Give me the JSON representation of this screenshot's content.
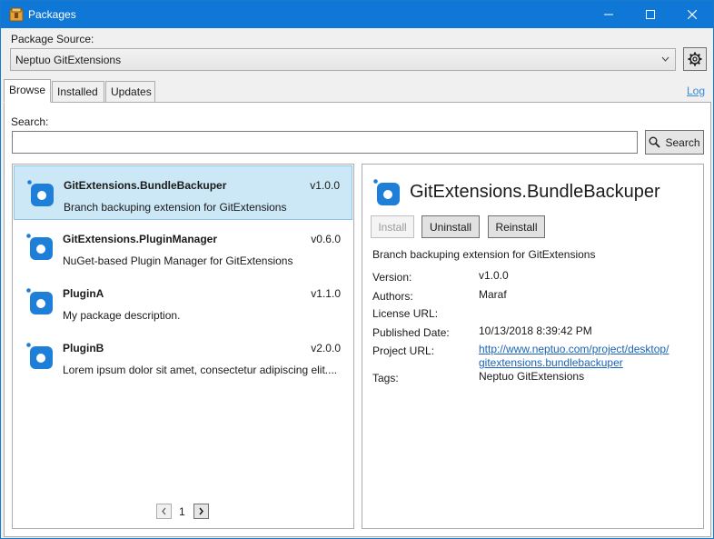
{
  "window": {
    "title": "Packages"
  },
  "source": {
    "label": "Package Source:",
    "selected": "Neptuo GitExtensions"
  },
  "tabs": [
    {
      "label": "Browse",
      "active": true
    },
    {
      "label": "Installed",
      "active": false
    },
    {
      "label": "Updates",
      "active": false
    }
  ],
  "log_link": "Log",
  "search": {
    "label": "Search:",
    "value": "",
    "button": "Search"
  },
  "packages": [
    {
      "name": "GitExtensions.BundleBackuper",
      "version": "v1.0.0",
      "description": "Branch backuping extension for GitExtensions",
      "selected": true
    },
    {
      "name": "GitExtensions.PluginManager",
      "version": "v0.6.0",
      "description": "NuGet-based Plugin Manager for GitExtensions",
      "selected": false
    },
    {
      "name": "PluginA",
      "version": "v1.1.0",
      "description": "My package description.",
      "selected": false
    },
    {
      "name": "PluginB",
      "version": "v2.0.0",
      "description": "Lorem ipsum dolor sit amet, consectetur adipiscing elit....",
      "selected": false
    }
  ],
  "pager": {
    "page": "1"
  },
  "detail": {
    "title": "GitExtensions.BundleBackuper",
    "buttons": {
      "install": "Install",
      "uninstall": "Uninstall",
      "reinstall": "Reinstall"
    },
    "description": "Branch backuping extension for GitExtensions",
    "props": {
      "version_label": "Version:",
      "version": "v1.0.0",
      "authors_label": "Authors:",
      "authors": "Maraf",
      "license_label": "License URL:",
      "license": "",
      "published_label": "Published Date:",
      "published": "10/13/2018 8:39:42 PM",
      "project_label": "Project URL:",
      "project_line1": "http://www.neptuo.com/project/desktop/",
      "project_line2": "gitextensions.bundlebackuper",
      "tags_label": "Tags:",
      "tags": "Neptuo GitExtensions"
    }
  },
  "colors": {
    "titlebar": "#0f78d7",
    "selection": "#cce8f6",
    "icon_blue": "#1e7fd8",
    "link": "#1a63b8"
  }
}
